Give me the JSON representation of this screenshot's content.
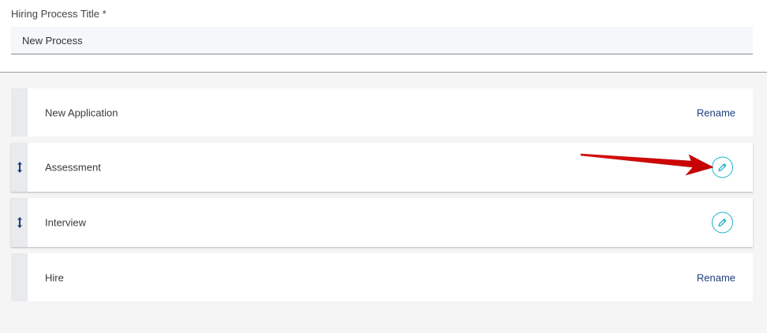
{
  "form": {
    "title_label": "Hiring Process Title *",
    "title_value": "New Process"
  },
  "stages": [
    {
      "name": "New Application",
      "action": "Rename",
      "draggable": false
    },
    {
      "name": "Assessment",
      "action_icon": "pencil-icon",
      "draggable": true
    },
    {
      "name": "Interview",
      "action_icon": "pencil-icon",
      "draggable": true
    },
    {
      "name": "Hire",
      "action": "Rename",
      "draggable": false
    }
  ],
  "colors": {
    "accent": "#1eb3c8",
    "link": "#1d3f7a",
    "annotation_arrow": "#e01010"
  }
}
